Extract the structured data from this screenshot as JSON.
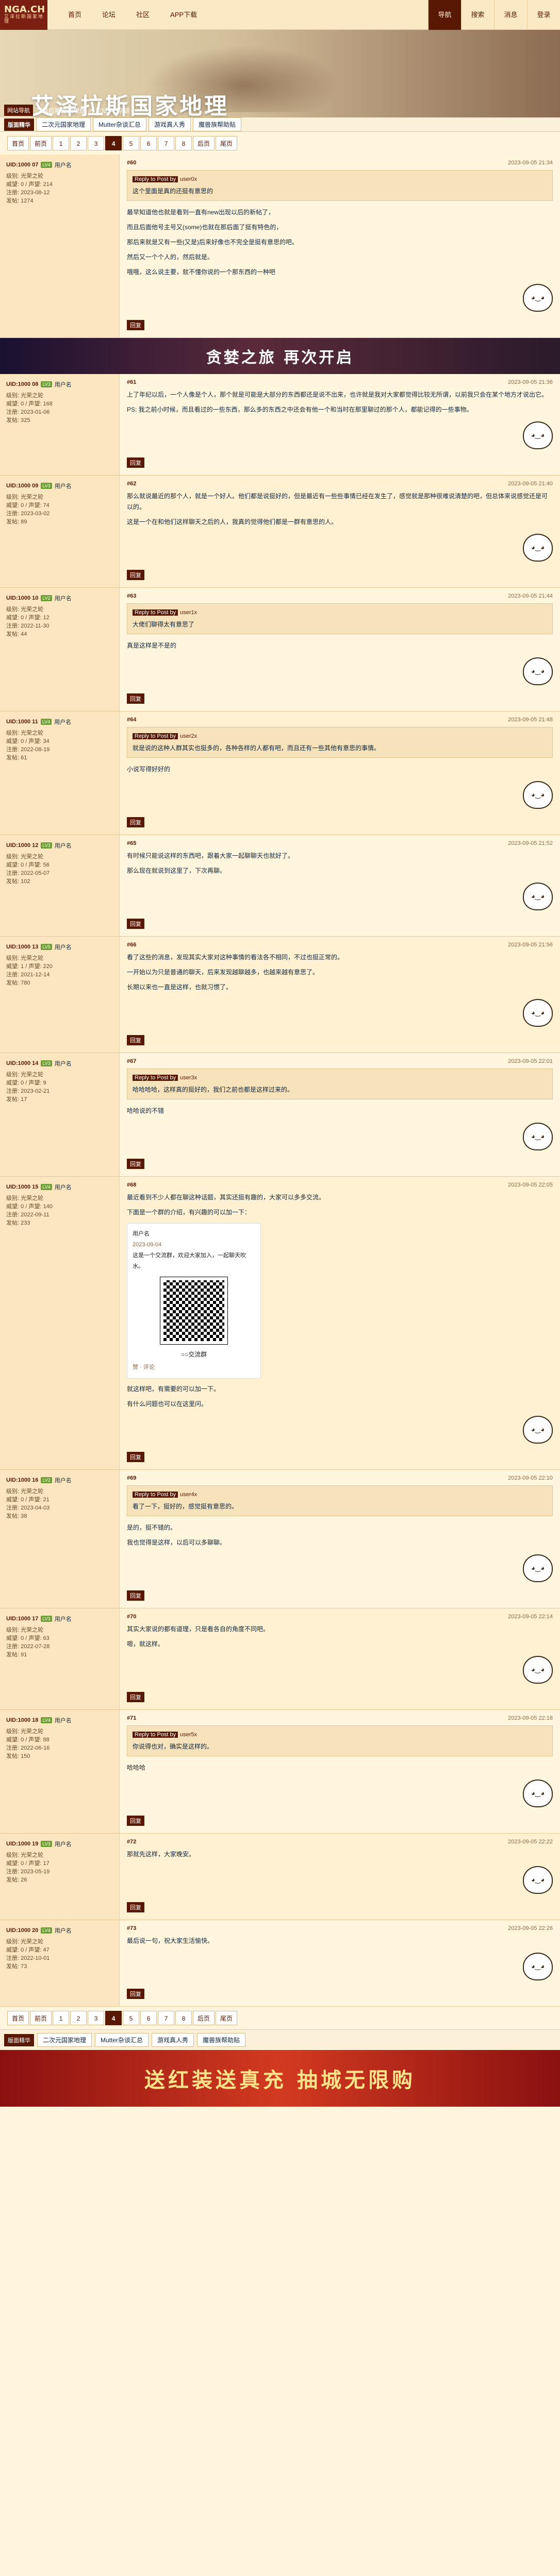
{
  "nav": {
    "logo": "NGA.CH",
    "logo_sub": "艾泽拉斯国家地理",
    "links": [
      "首页",
      "论坛",
      "社区",
      "APP下载"
    ],
    "right": [
      "导航",
      "搜索",
      "消息",
      "登录"
    ]
  },
  "banner": {
    "title": "艾泽拉斯国家地理",
    "home": "网站导航",
    "crumbs": [
      "艾泽拉斯国家地理",
      ">",
      "论坛",
      ">",
      "杂谈"
    ]
  },
  "tags": {
    "category": "版面精华",
    "items": [
      "二次元国家地理",
      "Mutter杂谈汇总",
      "游戏真人秀",
      "魔兽族帮助贴"
    ]
  },
  "pager": {
    "items": [
      "首页",
      "前页",
      "1",
      "2",
      "3",
      "4",
      "5",
      "6",
      "7",
      "8",
      "后页",
      "尾页"
    ],
    "current": "4"
  },
  "posts": [
    {
      "uid": "UID:1000 07",
      "level": "LV4",
      "uname": "用户名",
      "meta": [
        "级别: 光荣之轮",
        "威望: 0 / 声望: 214",
        "注册: 2023-08-12",
        "发帖: 1274"
      ],
      "floor": "#60",
      "time": "2023-09-05 21:34",
      "quote_head": "Reply to Post by",
      "quote_author": "user0x",
      "quote_text": "这个里面是真的还挺有意思的",
      "paragraphs": [
        "最早知道他也就是看到一直有new出现以后的新帖了，",
        "而且后面他号主号又(some)也就在那后面了挺有特色的，",
        "那后来就是又有一些(又是)后来好像也不完全是挺有意思的吧。",
        "然后又一个个人的，然后就是。"
      ],
      "last": "哦哦，这么说主要，就不懂你说的一个那东西的一种吧"
    },
    {
      "uid": "UID:1000 08",
      "level": "LV3",
      "uname": "用户名",
      "meta": [
        "级别: 光荣之轮",
        "威望: 0 / 声望: 168",
        "注册: 2023-01-06",
        "发帖: 325"
      ],
      "floor": "#61",
      "time": "2023-09-05 21:36",
      "paragraphs": [
        "上了年纪以后，一个人像是个人，那个就是可能是大部分的东西都还是说不出来，也许就是我对大家都觉得比较无所谓，以前我只会在某个地方才说出它。",
        "PS: 我之前小时候，而且看过的一些东西，那么多的东西之中还会有他一个和当时在那里聊过的那个人，都能记得的一些事物。"
      ]
    },
    {
      "uid": "UID:1000 09",
      "level": "LV3",
      "uname": "用户名",
      "meta": [
        "级别: 光荣之轮",
        "威望: 0 / 声望: 74",
        "注册: 2023-03-02",
        "发帖: 89"
      ],
      "floor": "#62",
      "time": "2023-09-05 21:40",
      "paragraphs": [
        "那么就说最近的那个人，就是一个好人。他们都是说挺好的，但是最近有一些些事情已经在发生了，感觉就是那种很难说清楚的吧，但总体来说感觉还是可以的。",
        "这是一个在和他们这样聊天之后的人，我真的觉得他们都是一群有意思的人。"
      ]
    },
    {
      "uid": "UID:1000 10",
      "level": "LV2",
      "uname": "用户名",
      "meta": [
        "级别: 光荣之轮",
        "威望: 0 / 声望: 12",
        "注册: 2022-11-30",
        "发帖: 44"
      ],
      "floor": "#63",
      "time": "2023-09-05 21:44",
      "quote_head": "Reply to Post by",
      "quote_author": "user1x",
      "quote_text": "大佬们聊得太有意思了",
      "paragraphs": [
        "真是这样是不是的"
      ]
    },
    {
      "uid": "UID:1000 11",
      "level": "LV4",
      "uname": "用户名",
      "meta": [
        "级别: 光荣之轮",
        "威望: 0 / 声望: 34",
        "注册: 2022-08-19",
        "发帖: 61"
      ],
      "floor": "#64",
      "time": "2023-09-05 21:48",
      "quote_head": "Reply to Post by",
      "quote_author": "user2x",
      "quote_text": "就是说的这种人群其实也挺多的，各种各样的人都有吧，而且还有一些其他有意思的事情。",
      "paragraphs": [
        "小说写得好好的"
      ]
    },
    {
      "uid": "UID:1000 12",
      "level": "LV3",
      "uname": "用户名",
      "meta": [
        "级别: 光荣之轮",
        "威望: 0 / 声望: 56",
        "注册: 2022-05-07",
        "发帖: 102"
      ],
      "floor": "#65",
      "time": "2023-09-05 21:52",
      "paragraphs": [
        "有时候只能说这样的东西吧，跟着大家一起聊聊天也就好了。",
        "那么现在就说到这里了，下次再聊。"
      ]
    },
    {
      "uid": "UID:1000 13",
      "level": "LV5",
      "uname": "用户名",
      "meta": [
        "级别: 光荣之轮",
        "威望: 1 / 声望: 220",
        "注册: 2021-12-14",
        "发帖: 780"
      ],
      "floor": "#66",
      "time": "2023-09-05 21:56",
      "paragraphs": [
        "看了这些的消息，发现其实大家对这种事情的看法各不相同，不过也挺正常的。",
        "一开始以为只是普通的聊天，后来发现越聊越多，也越来越有意思了。",
        "长期以来也一直是这样，也就习惯了。"
      ]
    },
    {
      "uid": "UID:1000 14",
      "level": "LV3",
      "uname": "用户名",
      "meta": [
        "级别: 光荣之轮",
        "威望: 0 / 声望: 9",
        "注册: 2023-02-21",
        "发帖: 17"
      ],
      "floor": "#67",
      "time": "2023-09-05 22:01",
      "quote_head": "Reply to Post by",
      "quote_author": "user3x",
      "quote_text": "哈哈哈哈，这样真的挺好的，我们之前也都是这样过来的。",
      "paragraphs": [
        "哈哈说的不错"
      ]
    },
    {
      "uid": "UID:1000 15",
      "level": "LV4",
      "uname": "用户名",
      "meta": [
        "级别: 光荣之轮",
        "威望: 0 / 声望: 140",
        "注册: 2022-09-11",
        "发帖: 233"
      ],
      "floor": "#68",
      "time": "2023-09-05 22:05",
      "paragraphs": [
        "最近看到不少人都在聊这种话题，其实还挺有趣的，大家可以多多交流。",
        "下面是一个群的介绍，有兴趣的可以加一下："
      ],
      "qr": {
        "name": "用户名",
        "date": "2023-09-04",
        "desc": "这是一个交流群，欢迎大家加入，一起聊天吹水。",
        "group": "○○交流群",
        "likes": "赞",
        "comments": "评论"
      },
      "after": [
        "就这样吧，有需要的可以加一下。",
        "有什么问题也可以在这里问。"
      ]
    },
    {
      "uid": "UID:1000 16",
      "level": "LV2",
      "uname": "用户名",
      "meta": [
        "级别: 光荣之轮",
        "威望: 0 / 声望: 21",
        "注册: 2023-04-03",
        "发帖: 38"
      ],
      "floor": "#69",
      "time": "2023-09-05 22:10",
      "quote_head": "Reply to Post by",
      "quote_author": "user4x",
      "quote_text": "看了一下，挺好的，感觉挺有意思的。",
      "paragraphs": [
        "是的，挺不错的。",
        "我也觉得是这样，以后可以多聊聊。"
      ]
    },
    {
      "uid": "UID:1000 17",
      "level": "LV3",
      "uname": "用户名",
      "meta": [
        "级别: 光荣之轮",
        "威望: 0 / 声望: 63",
        "注册: 2022-07-28",
        "发帖: 91"
      ],
      "floor": "#70",
      "time": "2023-09-05 22:14",
      "paragraphs": [
        "其实大家说的都有道理，只是看各自的角度不同吧。",
        "嗯，就这样。"
      ]
    },
    {
      "uid": "UID:1000 18",
      "level": "LV4",
      "uname": "用户名",
      "meta": [
        "级别: 光荣之轮",
        "威望: 0 / 声望: 88",
        "注册: 2022-06-16",
        "发帖: 150"
      ],
      "floor": "#71",
      "time": "2023-09-05 22:18",
      "quote_head": "Reply to Post by",
      "quote_author": "user5x",
      "quote_text": "你说得也对，确实是这样的。",
      "paragraphs": [
        "哈哈哈"
      ]
    },
    {
      "uid": "UID:1000 19",
      "level": "LV3",
      "uname": "用户名",
      "meta": [
        "级别: 光荣之轮",
        "威望: 0 / 声望: 17",
        "注册: 2023-05-19",
        "发帖: 26"
      ],
      "floor": "#72",
      "time": "2023-09-05 22:22",
      "paragraphs": [
        "那就先这样，大家晚安。"
      ]
    },
    {
      "uid": "UID:1000 20",
      "level": "LV4",
      "uname": "用户名",
      "meta": [
        "级别: 光荣之轮",
        "威望: 0 / 声望: 47",
        "注册: 2022-10-01",
        "发帖: 73"
      ],
      "floor": "#73",
      "time": "2023-09-05 22:26",
      "paragraphs": [
        "最后说一句，祝大家生活愉快。"
      ]
    }
  ],
  "ad": {
    "top": "贪婪之旅 再次开启",
    "bottom": "送红装送真充 抽城无限购"
  }
}
